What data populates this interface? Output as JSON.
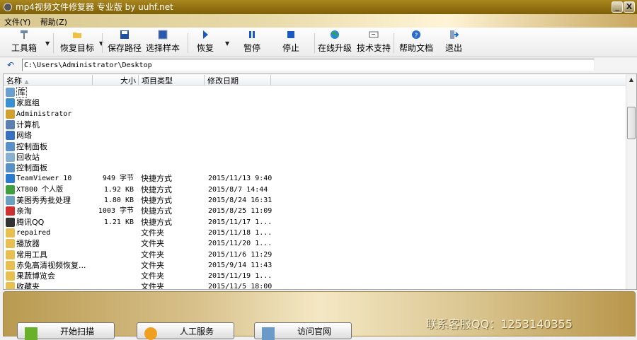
{
  "window": {
    "title": "mp4视频文件修复器 专业版 by uuhf.net",
    "minimize": "_",
    "close": "X"
  },
  "menu": [
    "文件(Y)",
    "帮助(Z)"
  ],
  "toolbar": [
    {
      "label": "工具箱",
      "icon": "toolbox-icon"
    },
    {
      "label": "恢复目标",
      "icon": "folder-open-icon"
    },
    {
      "label": "保存路径",
      "icon": "save-icon"
    },
    {
      "label": "选择样本",
      "icon": "select-sample-icon"
    },
    {
      "label": "恢复",
      "icon": "play-icon"
    },
    {
      "label": "暂停",
      "icon": "pause-icon"
    },
    {
      "label": "停止",
      "icon": "stop-icon"
    },
    {
      "label": "在线升级",
      "icon": "globe-icon"
    },
    {
      "label": "技术支持",
      "icon": "support-icon"
    },
    {
      "label": "帮助文档",
      "icon": "help-icon"
    },
    {
      "label": "退出",
      "icon": "exit-icon"
    }
  ],
  "path": "C:\\Users\\Administrator\\Desktop",
  "columns": [
    "名称",
    "大小",
    "项目类型",
    "修改日期"
  ],
  "files": [
    {
      "name": "库",
      "size": "",
      "type": "",
      "date": "",
      "color": "#6a9fd0"
    },
    {
      "name": "家庭组",
      "size": "",
      "type": "",
      "date": "",
      "color": "#3a8fd0"
    },
    {
      "name": "Administrator",
      "size": "",
      "type": "",
      "date": "",
      "color": "#d0a030"
    },
    {
      "name": "计算机",
      "size": "",
      "type": "",
      "date": "",
      "color": "#5a7fb0"
    },
    {
      "name": "网络",
      "size": "",
      "type": "",
      "date": "",
      "color": "#3a70c0"
    },
    {
      "name": "控制面板",
      "size": "",
      "type": "",
      "date": "",
      "color": "#5a90c8"
    },
    {
      "name": "回收站",
      "size": "",
      "type": "",
      "date": "",
      "color": "#8ab0d0"
    },
    {
      "name": "控制面板",
      "size": "",
      "type": "",
      "date": "",
      "color": "#5a90c8"
    },
    {
      "name": "TeamViewer 10",
      "size": "949 字节",
      "type": "快捷方式",
      "date": "2015/11/13 9:40",
      "color": "#2a7ad0"
    },
    {
      "name": "XT800 个人版",
      "size": "1.92 KB",
      "type": "快捷方式",
      "date": "2015/8/7 14:44",
      "color": "#40a040"
    },
    {
      "name": "美图秀秀批处理",
      "size": "1.80 KB",
      "type": "快捷方式",
      "date": "2015/8/24 16:31",
      "color": "#6aa0c0"
    },
    {
      "name": "亲淘",
      "size": "1003 字节",
      "type": "快捷方式",
      "date": "2015/8/25 11:09",
      "color": "#d03030"
    },
    {
      "name": "腾讯QQ",
      "size": "1.21 KB",
      "type": "快捷方式",
      "date": "2015/11/17 1...",
      "color": "#333333"
    },
    {
      "name": "repaired",
      "size": "",
      "type": "文件夹",
      "date": "2015/11/18 1...",
      "color": "#e8c050"
    },
    {
      "name": "播放器",
      "size": "",
      "type": "文件夹",
      "date": "2015/11/20 1...",
      "color": "#e8c050"
    },
    {
      "name": "常用工具",
      "size": "",
      "type": "文件夹",
      "date": "2015/11/6 11:29",
      "color": "#e8c050"
    },
    {
      "name": "赤兔高清视频恢复...",
      "size": "",
      "type": "文件夹",
      "date": "2015/9/14 11:43",
      "color": "#e8c050"
    },
    {
      "name": "果蔬博览会",
      "size": "",
      "type": "文件夹",
      "date": "2015/11/19 1...",
      "color": "#e8c050"
    },
    {
      "name": "收藏夹",
      "size": "",
      "type": "文件夹",
      "date": "2015/11/5 18:00",
      "color": "#e8c050"
    }
  ],
  "bottom": {
    "buttons": [
      "开始扫描",
      "人工服务",
      "访问官网"
    ],
    "contact": "联系客服QQ：1253140355"
  }
}
